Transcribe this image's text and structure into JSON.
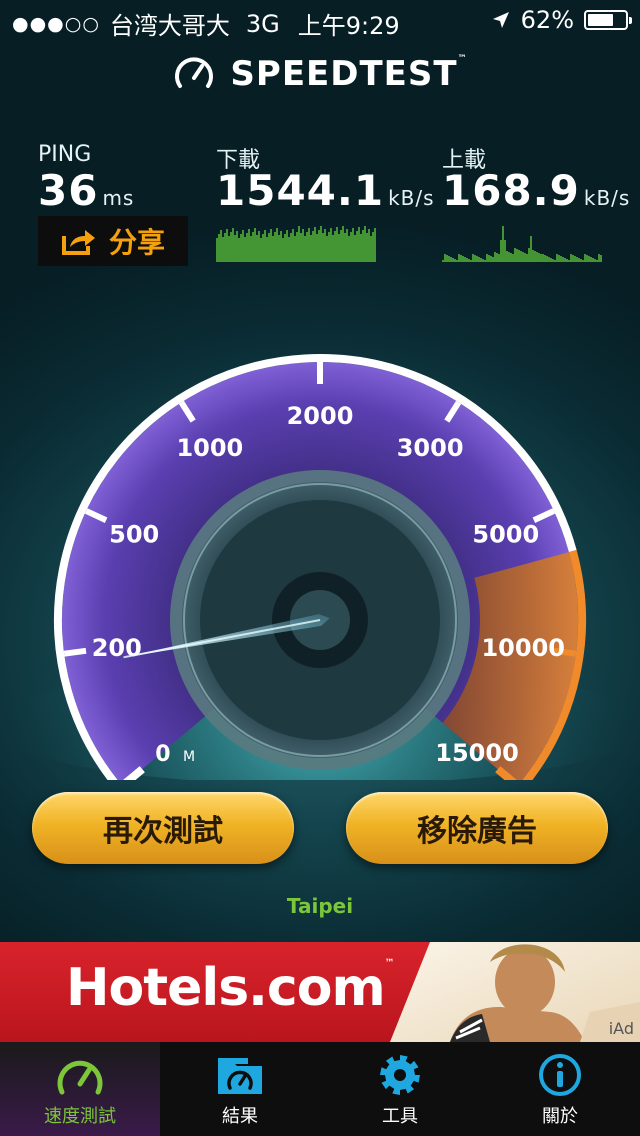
{
  "status_bar": {
    "signal": "●●●○○",
    "carrier": "台湾大哥大",
    "network": "3G",
    "time": "上午9:29",
    "battery": "62%"
  },
  "header": {
    "title": "SPEEDTEST",
    "tm": "™"
  },
  "ping": {
    "label": "PING",
    "value": "36",
    "unit": "ms"
  },
  "download": {
    "label": "下載",
    "value": "1544.1",
    "unit": "kB/s"
  },
  "upload": {
    "label": "上載",
    "value": "168.9",
    "unit": "kB/s"
  },
  "share": {
    "label": "分享"
  },
  "gauge": {
    "scale_labels": [
      "0",
      "200",
      "500",
      "1000",
      "2000",
      "3000",
      "5000",
      "10000",
      "15000"
    ],
    "unit_mark": "M",
    "needle_label_index": 0.9
  },
  "actions": {
    "retest": "再次測試",
    "remove_ads": "移除廣告"
  },
  "server": {
    "location": "Taipei"
  },
  "ad": {
    "brand": "Hotels.com",
    "brand_tm": "™",
    "tag": "iAd"
  },
  "tabs": [
    {
      "label": "速度測試",
      "icon": "speedometer-icon",
      "active": true
    },
    {
      "label": "結果",
      "icon": "results-folder-icon",
      "active": false
    },
    {
      "label": "工具",
      "icon": "gear-icon",
      "active": false
    },
    {
      "label": "關於",
      "icon": "info-icon",
      "active": false
    }
  ],
  "colors": {
    "accent_green": "#7cc63a",
    "share_orange": "#f5a10d",
    "tab_blue": "#1fa8e0",
    "gauge_orange": "#f08a2a",
    "gauge_purple": "#6b4cc2"
  }
}
